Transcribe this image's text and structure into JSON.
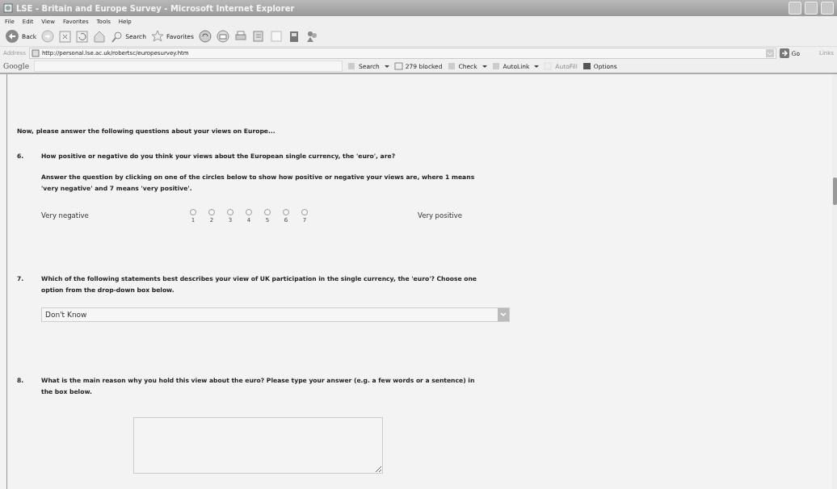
{
  "window": {
    "title": "LSE - Britain and Europe Survey - Microsoft Internet Explorer"
  },
  "menu": [
    "File",
    "Edit",
    "View",
    "Favorites",
    "Tools",
    "Help"
  ],
  "toolbar": {
    "back": "Back",
    "search": "Search",
    "favorites": "Favorites"
  },
  "address_bar": {
    "label": "Address",
    "url": "http://personal.lse.ac.uk/robertsc/europesurvey.htm",
    "go": "Go",
    "links": "Links"
  },
  "google_toolbar": {
    "logo": "Google",
    "items": [
      {
        "label": "Search",
        "kind": "dropdown",
        "disabled": false
      },
      {
        "label": "279 blocked",
        "kind": "blocked",
        "disabled": false
      },
      {
        "label": "Check",
        "kind": "dropdown",
        "disabled": false
      },
      {
        "label": "AutoLink",
        "kind": "dropdown",
        "disabled": false
      },
      {
        "label": "AutoFill",
        "kind": "button",
        "disabled": true
      },
      {
        "label": "Options",
        "kind": "options",
        "disabled": false
      }
    ]
  },
  "survey": {
    "intro": "Now, please answer the following questions about your views on Europe...",
    "questions": [
      {
        "kind": "scale",
        "number": "6.",
        "text": "How positive or negative do you think your views about the European single currency, the 'euro', are?",
        "instructions": "Answer the question by clicking on one of the circles below to show how positive or negative your views are, where 1 means 'very negative' and 7 means 'very positive'.",
        "low_label": "Very negative",
        "high_label": "Very positive",
        "options": [
          {
            "label": "1",
            "selected": false
          },
          {
            "label": "2",
            "selected": false
          },
          {
            "label": "3",
            "selected": false
          },
          {
            "label": "4",
            "selected": false
          },
          {
            "label": "5",
            "selected": false
          },
          {
            "label": "6",
            "selected": false
          },
          {
            "label": "7",
            "selected": false
          }
        ]
      },
      {
        "kind": "dropdown",
        "number": "7.",
        "text": "Which of the following statements best describes your view of UK participation in the single currency, the 'euro'?  Choose one option from the drop-down box below.",
        "value": "Don't Know"
      },
      {
        "kind": "textarea",
        "number": "8.",
        "text": "What is the main reason why you hold this view about the euro?  Please type your answer (e.g. a few words or a sentence) in the box below."
      }
    ]
  }
}
